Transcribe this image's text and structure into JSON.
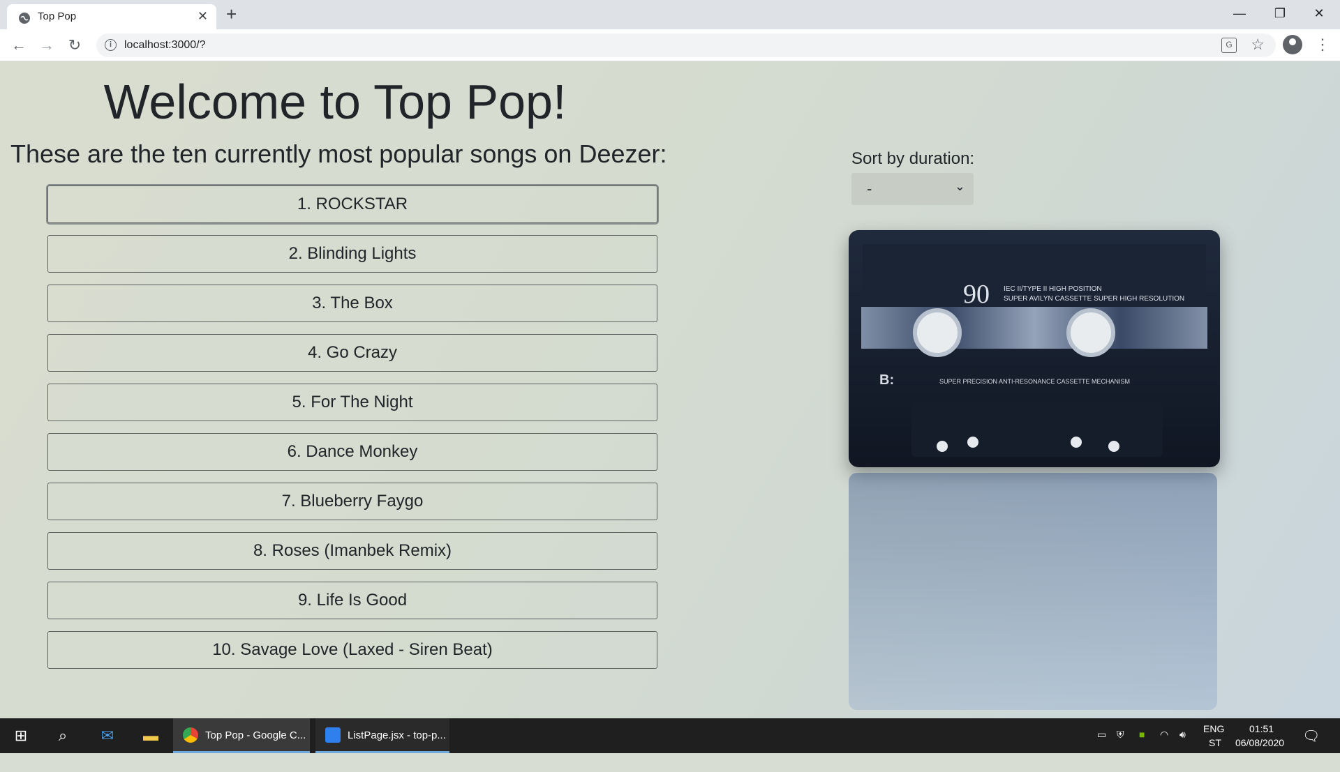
{
  "browser": {
    "tab_title": "Top Pop",
    "url": "localhost:3000/?"
  },
  "page": {
    "heading": "Welcome to Top Pop!",
    "subtitle": "These are the ten currently most popular songs on Deezer:",
    "songs": [
      "1. ROCKSTAR",
      "2. Blinding Lights",
      "3. The Box",
      "4. Go Crazy",
      "5. For The Night",
      "6. Dance Monkey",
      "7. Blueberry Faygo",
      "8. Roses (Imanbek Remix)",
      "9. Life Is Good",
      "10. Savage Love (Laxed - Siren Beat)"
    ],
    "sort": {
      "label": "Sort by duration:",
      "selected": "-"
    },
    "cassette": {
      "number": "90",
      "spec_line1": "IEC II/TYPE II HIGH POSITION",
      "spec_line2": "SUPER AVILYN CASSETTE SUPER HIGH RESOLUTION",
      "side": "B:",
      "mechanism": "SUPER PRECISION ANTI-RESONANCE CASSETTE MECHANISM"
    }
  },
  "taskbar": {
    "apps": [
      {
        "label": "Top Pop - Google C..."
      },
      {
        "label": "ListPage.jsx - top-p..."
      }
    ],
    "language": "ENG",
    "language_sub": "ST",
    "time": "01:51",
    "date": "06/08/2020"
  }
}
